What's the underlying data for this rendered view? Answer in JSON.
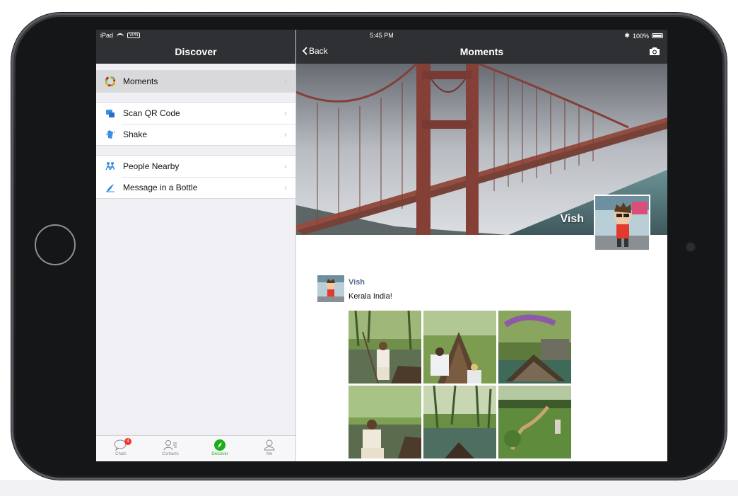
{
  "status_bar": {
    "device": "iPad",
    "time": "5:45 PM",
    "battery": "100%"
  },
  "left": {
    "title": "Discover",
    "groups": [
      [
        {
          "label": "Moments",
          "icon": "moments-icon"
        }
      ],
      [
        {
          "label": "Scan QR Code",
          "icon": "qr-code-icon"
        },
        {
          "label": "Shake",
          "icon": "shake-icon"
        }
      ],
      [
        {
          "label": "People Nearby",
          "icon": "people-nearby-icon"
        },
        {
          "label": "Message in a Bottle",
          "icon": "bottle-icon"
        }
      ]
    ],
    "active_item": "Moments"
  },
  "tabbar": {
    "tabs": [
      {
        "label": "Chats",
        "badge": "4"
      },
      {
        "label": "Contacts"
      },
      {
        "label": "Discover"
      },
      {
        "label": "Me"
      }
    ],
    "active_tab": "Discover"
  },
  "right": {
    "back_label": "Back",
    "title": "Moments",
    "profile_name": "Vish",
    "post": {
      "author": "Vish",
      "text": "Kerala India!",
      "photo_count": 6
    }
  },
  "colors": {
    "nav_bar": "#2f3033",
    "accent_green": "#1aad19",
    "badge_red": "#f43530",
    "author_link": "#576b95"
  }
}
